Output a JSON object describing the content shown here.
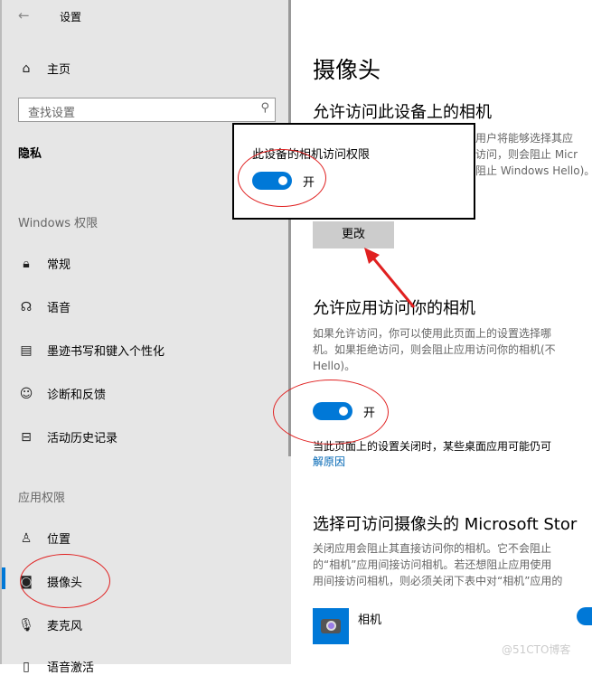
{
  "window": {
    "title": "设置"
  },
  "sidebar": {
    "home": "主页",
    "search_placeholder": "查找设置",
    "category": "隐私",
    "section_windows": "Windows 权限",
    "windows_items": [
      {
        "label": "常规",
        "icon": "lock-icon"
      },
      {
        "label": "语音",
        "icon": "speech-icon"
      },
      {
        "label": "墨迹书写和键入个性化",
        "icon": "ink-icon"
      },
      {
        "label": "诊断和反馈",
        "icon": "feedback-icon"
      },
      {
        "label": "活动历史记录",
        "icon": "history-icon"
      }
    ],
    "section_apps": "应用权限",
    "app_items": [
      {
        "label": "位置",
        "icon": "location-icon"
      },
      {
        "label": "摄像头",
        "icon": "camera-icon"
      },
      {
        "label": "麦克风",
        "icon": "microphone-icon"
      },
      {
        "label": "语音激活",
        "icon": "voice-activation-icon"
      }
    ]
  },
  "main": {
    "title": "摄像头",
    "device_heading": "允许访问此设备上的相机",
    "device_desc": [
      "用户将能够选择其应",
      "访问，则会阻止 Micr",
      "阻止 Windows Hello)。"
    ],
    "change_button": "更改",
    "apps_heading": "允许应用访问你的相机",
    "apps_desc": [
      "如果允许访问，你可以使用此页面上的设置选择哪",
      "机。如果拒绝访问，则会阻止应用访问你的相机(不",
      "Hello)。"
    ],
    "apps_toggle_label": "开",
    "apps_note": "当此页面上的设置关闭时，某些桌面应用可能仍可",
    "learn_more": "解原因",
    "store_heading": "选择可访问摄像头的 Microsoft Stor",
    "store_desc": [
      "关闭应用会阻止其直接访问你的相机。它不会阻止",
      "的“相机”应用间接访问相机。若还想阻止应用使用",
      "用间接访问相机，则必须关闭下表中对“相机”应用的"
    ],
    "app_list": [
      {
        "name": "相机"
      }
    ]
  },
  "popup": {
    "title": "此设备的相机访问权限",
    "toggle_label": "开"
  },
  "watermark": "@51CTO博客"
}
